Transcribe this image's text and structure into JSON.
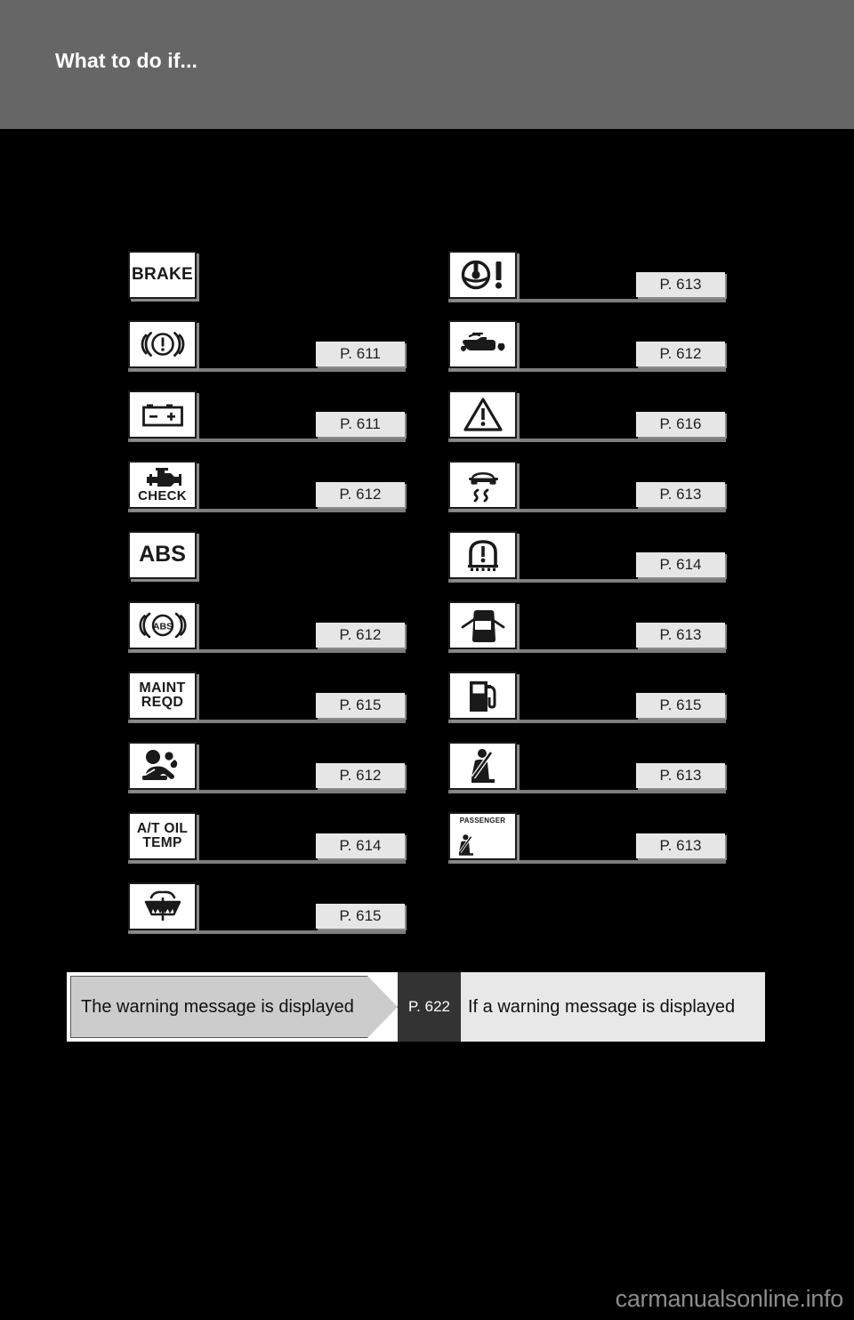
{
  "header": {
    "title": "What to do if..."
  },
  "columns": {
    "left": [
      {
        "icon": "brake-text-warning-icon",
        "label": "BRAKE",
        "page": ""
      },
      {
        "icon": "brake-system-warning-icon",
        "label": "",
        "page": "P. 611"
      },
      {
        "icon": "battery-charge-warning-icon",
        "label": "",
        "page": "P. 611"
      },
      {
        "icon": "check-engine-warning-icon",
        "label": "CHECK",
        "page": "P. 612"
      },
      {
        "icon": "abs-text-warning-icon",
        "label": "ABS",
        "page": ""
      },
      {
        "icon": "abs-system-warning-icon",
        "label": "ABS",
        "page": "P. 612"
      },
      {
        "icon": "maintenance-required-icon",
        "label": "MAINT REQD",
        "page": "P. 615"
      },
      {
        "icon": "srs-airbag-warning-icon",
        "label": "",
        "page": "P. 612"
      },
      {
        "icon": "at-oil-temp-warning-icon",
        "label": "A/T OIL TEMP",
        "page": "P. 614"
      },
      {
        "icon": "washer-fluid-warning-icon",
        "label": "",
        "page": "P. 615"
      }
    ],
    "right": [
      {
        "icon": "power-steering-warning-icon",
        "label": "",
        "page": "P. 613"
      },
      {
        "icon": "engine-oil-pressure-icon",
        "label": "",
        "page": "P. 612"
      },
      {
        "icon": "master-warning-icon",
        "label": "",
        "page": "P. 616"
      },
      {
        "icon": "slip-indicator-icon",
        "label": "",
        "page": "P. 613"
      },
      {
        "icon": "tire-pressure-warning-icon",
        "label": "",
        "page": "P. 614"
      },
      {
        "icon": "door-open-warning-icon",
        "label": "",
        "page": "P. 613"
      },
      {
        "icon": "low-fuel-level-icon",
        "label": "",
        "page": "P. 615"
      },
      {
        "icon": "seat-belt-reminder-icon",
        "label": "",
        "page": "P. 613"
      },
      {
        "icon": "passenger-seat-belt-icon",
        "label": "PASSENGER",
        "page": "P. 613"
      }
    ]
  },
  "banner": {
    "condition": "The warning message is displayed",
    "page": "P. 622",
    "action": "If a warning message is displayed"
  },
  "footer": {
    "watermark": "carmanualsonline.info"
  },
  "colors": {
    "header_bg": "#666666",
    "page_bg": "#000000",
    "tile_bg": "#ffffff",
    "tag_bg": "#e6e6e6",
    "rule": "#7d7d7d",
    "banner_arrow": "#cccccc",
    "banner_page_bg": "#333333",
    "banner_right_bg": "#e8e8e8"
  }
}
